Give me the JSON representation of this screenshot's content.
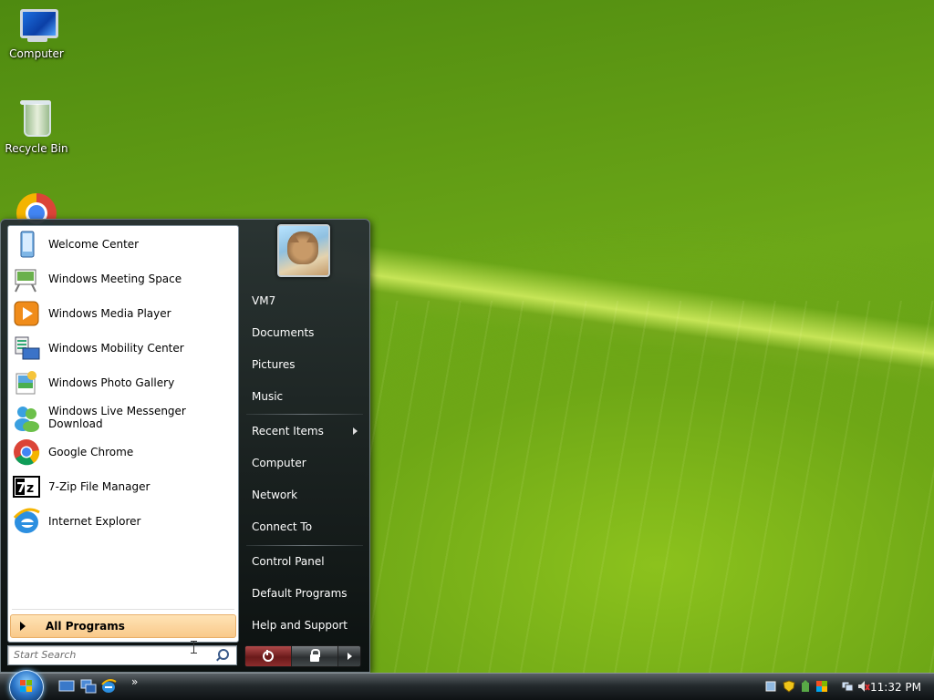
{
  "desktop": {
    "icons": [
      {
        "label": "Computer"
      },
      {
        "label": "Recycle Bin"
      }
    ]
  },
  "start_menu": {
    "programs": [
      {
        "label": "Welcome Center",
        "icon": "welcome-center-icon"
      },
      {
        "label": "Windows Meeting Space",
        "icon": "meeting-space-icon"
      },
      {
        "label": "Windows Media Player",
        "icon": "media-player-icon"
      },
      {
        "label": "Windows Mobility Center",
        "icon": "mobility-center-icon"
      },
      {
        "label": "Windows Photo Gallery",
        "icon": "photo-gallery-icon"
      },
      {
        "label": "Windows Live Messenger Download",
        "icon": "messenger-icon"
      },
      {
        "label": "Google Chrome",
        "icon": "chrome-icon"
      },
      {
        "label": "7-Zip File Manager",
        "icon": "seven-zip-icon"
      },
      {
        "label": "Internet Explorer",
        "icon": "internet-explorer-icon"
      }
    ],
    "all_programs": "All Programs",
    "search_placeholder": "Start Search",
    "right": {
      "user": "VM7",
      "documents": "Documents",
      "pictures": "Pictures",
      "music": "Music",
      "recent_items": "Recent Items",
      "computer": "Computer",
      "network": "Network",
      "connect_to": "Connect To",
      "control_panel": "Control Panel",
      "default_programs": "Default Programs",
      "help_support": "Help and Support"
    }
  },
  "taskbar": {
    "clock": "11:32 PM",
    "chevron": "»"
  },
  "colors": {
    "all_programs_bg": "#f9c98a",
    "power_button": "#8d2d2d",
    "desktop_green": "#6ca818"
  }
}
